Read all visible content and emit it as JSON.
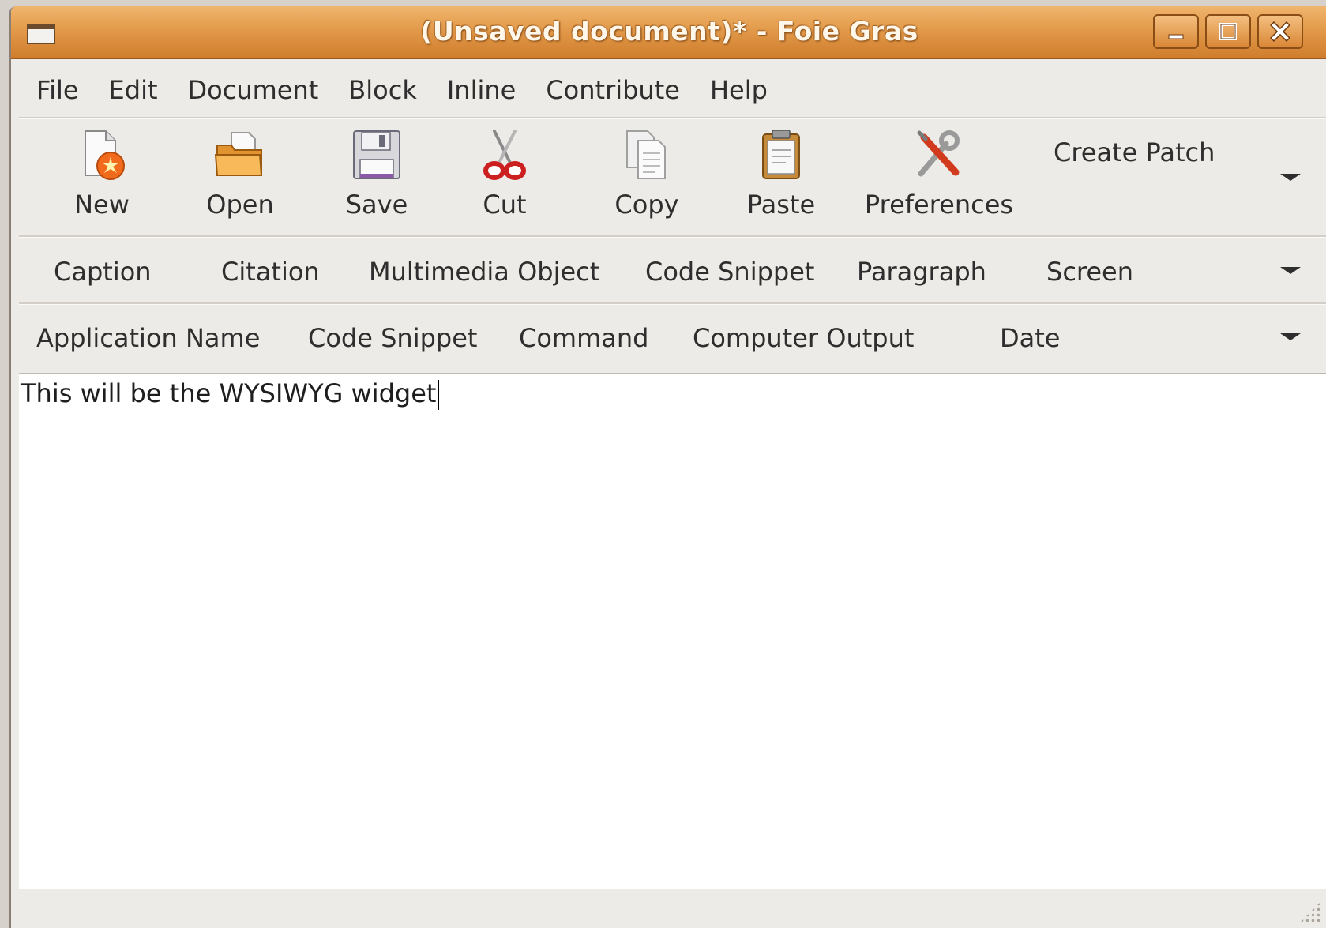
{
  "window": {
    "title": "(Unsaved document)* - Foie Gras",
    "controls": {
      "minimize": "minimize-icon",
      "maximize": "maximize-icon",
      "close": "close-icon"
    }
  },
  "menubar": {
    "items": [
      "File",
      "Edit",
      "Document",
      "Block",
      "Inline",
      "Contribute",
      "Help"
    ]
  },
  "toolbar": {
    "new_label": "New",
    "open_label": "Open",
    "save_label": "Save",
    "cut_label": "Cut",
    "copy_label": "Copy",
    "paste_label": "Paste",
    "preferences_label": "Preferences",
    "create_patch_label": "Create Patch"
  },
  "block_bar": {
    "items": [
      "Caption",
      "Citation",
      "Multimedia Object",
      "Code Snippet",
      "Paragraph",
      "Screen"
    ]
  },
  "inline_bar": {
    "items": [
      "Application Name",
      "Code Snippet",
      "Command",
      "Computer Output",
      "Date"
    ]
  },
  "editor": {
    "text": "This will be the WYSIWYG widget"
  },
  "colors": {
    "titlebar": "#e29a4a",
    "window_bg": "#edebe7",
    "editor_bg": "#ffffff",
    "text": "#2e2e2e"
  }
}
